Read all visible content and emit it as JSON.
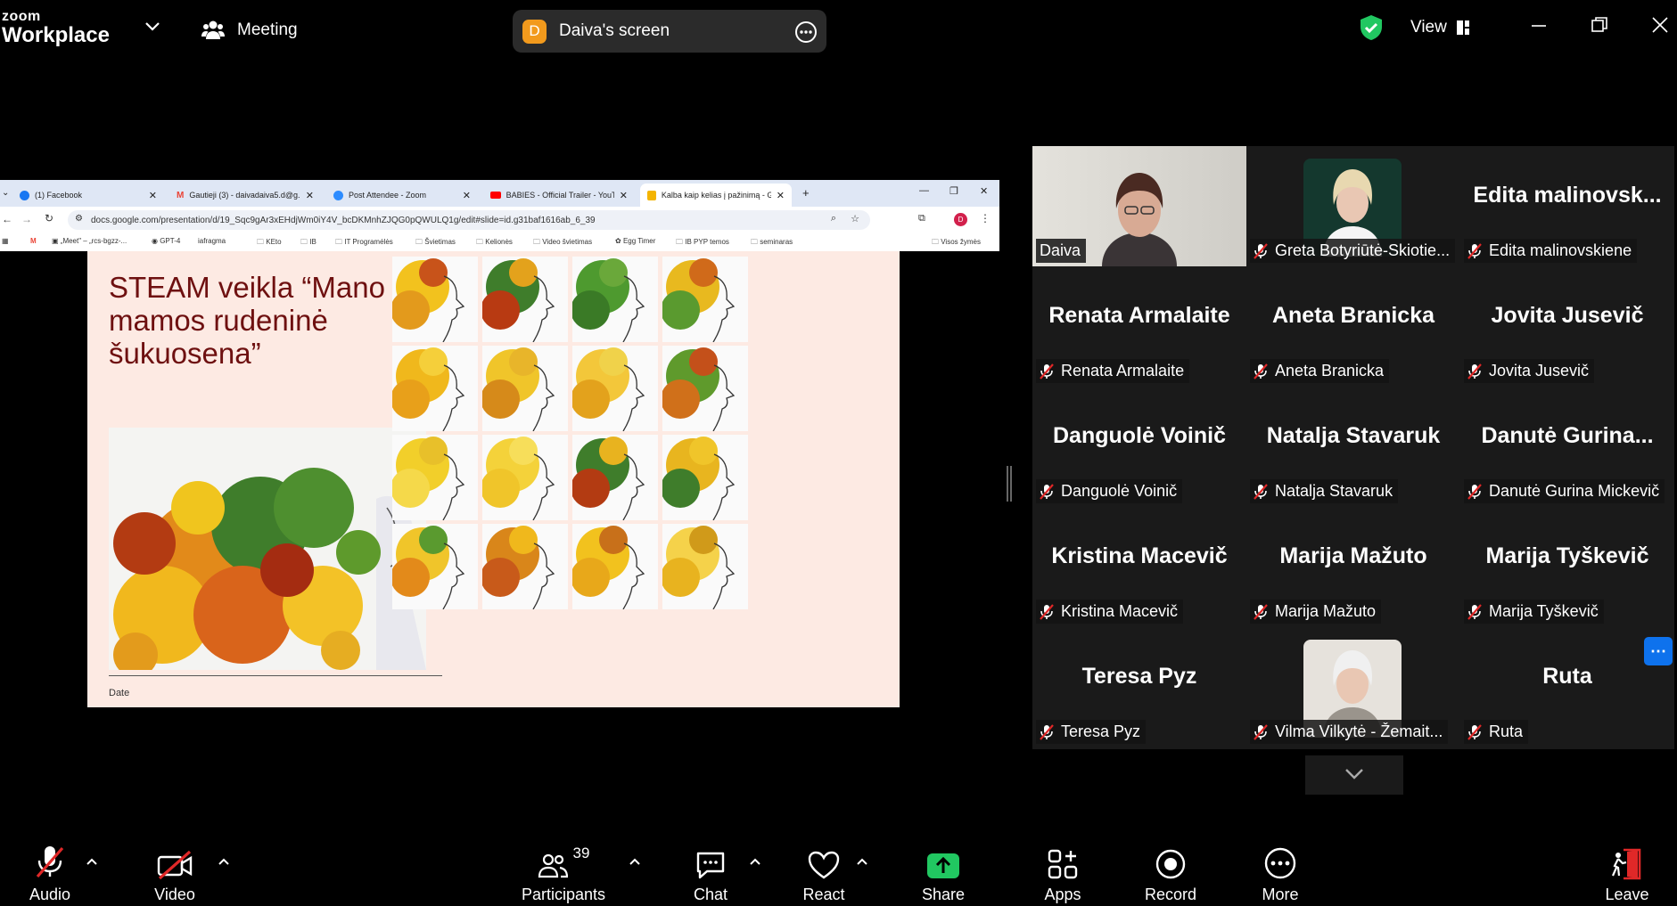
{
  "app": {
    "logo_top": "zoom",
    "logo_bottom": "Workplace",
    "meeting_label": "Meeting",
    "share_badge": "D",
    "share_title": "Daiva's screen",
    "view_label": "View"
  },
  "browser": {
    "tabs": [
      {
        "label": "(1) Facebook",
        "icon": "facebook-icon",
        "color": "#1877f2"
      },
      {
        "label": "Gautieji (3) - daivadaiva5.d@g...",
        "icon": "gmail-icon",
        "color": "#ea4335"
      },
      {
        "label": "Post Attendee - Zoom",
        "icon": "zoom-icon",
        "color": "#2d8cff"
      },
      {
        "label": "BABIES - Official Trailer - YouTu...",
        "icon": "youtube-icon",
        "color": "#ff0000"
      },
      {
        "label": "Kalba kaip kelias į pažinimą - G...",
        "icon": "slides-icon",
        "color": "#f4b400"
      }
    ],
    "url": "docs.google.com/presentation/d/19_Sqc9gAr3xEHdjWm0iY4V_bcDKMnhZJQG0pQWULQ1g/edit#slide=id.g31baf1616ab_6_39",
    "profile_initial": "D",
    "bookmarks": [
      "„Meet\" – „rcs-bgzz-...",
      "GPT-4",
      "iafragma",
      "KEto",
      "IB",
      "IT Programėlės",
      "Švietimas",
      "Kelionės",
      "Video švietimas",
      "Egg Timer",
      "IB PYP temos",
      "seminaras"
    ],
    "bookmarks_right": "Visos žymės"
  },
  "slide": {
    "title": "STEAM veikla “Mano mamos rudeninė šukuosena”",
    "date": "Date"
  },
  "participants": [
    {
      "big": "",
      "tag": "Daiva",
      "speaking": true,
      "muted": false,
      "video": true
    },
    {
      "big": "",
      "tag": "Greta Botyriūtė-Skiotie...",
      "muted": true,
      "photo": "portrait-photo"
    },
    {
      "big": "Edita  malinovsk...",
      "tag": "Edita malinovskiene",
      "muted": true
    },
    {
      "big": "Renata Armalaite",
      "tag": "Renata Armalaite",
      "muted": true
    },
    {
      "big": "Aneta Branicka",
      "tag": "Aneta Branicka",
      "muted": true
    },
    {
      "big": "Jovita Jusevič",
      "tag": "Jovita Jusevič",
      "muted": true
    },
    {
      "big": "Danguolė Voinič",
      "tag": "Danguolė Voinič",
      "muted": true
    },
    {
      "big": "Natalja Stavaruk",
      "tag": "Natalja Stavaruk",
      "muted": true
    },
    {
      "big": "Danutė  Gurina...",
      "tag": "Danutė Gurina Mickevič",
      "muted": true
    },
    {
      "big": "Kristina Macevič",
      "tag": "Kristina Macevič",
      "muted": true
    },
    {
      "big": "Marija Mažuto",
      "tag": "Marija Mažuto",
      "muted": true
    },
    {
      "big": "Marija Tyškevič",
      "tag": "Marija Tyškevič",
      "muted": true
    },
    {
      "big": "Teresa Pyz",
      "tag": "Teresa Pyz",
      "muted": true
    },
    {
      "big": "",
      "tag": "Vilma Vilkytė - Žemait...",
      "muted": true,
      "photo": "portrait-photo"
    },
    {
      "big": "Ruta",
      "tag": "Ruta",
      "muted": true
    }
  ],
  "toolbar": {
    "audio": "Audio",
    "video": "Video",
    "participants": "Participants",
    "participants_count": "39",
    "chat": "Chat",
    "react": "React",
    "share": "Share",
    "apps": "Apps",
    "record": "Record",
    "more": "More",
    "leave": "Leave",
    "share_color": "#21c761",
    "leave_color": "#e02828",
    "muted_color": "#e02828"
  }
}
